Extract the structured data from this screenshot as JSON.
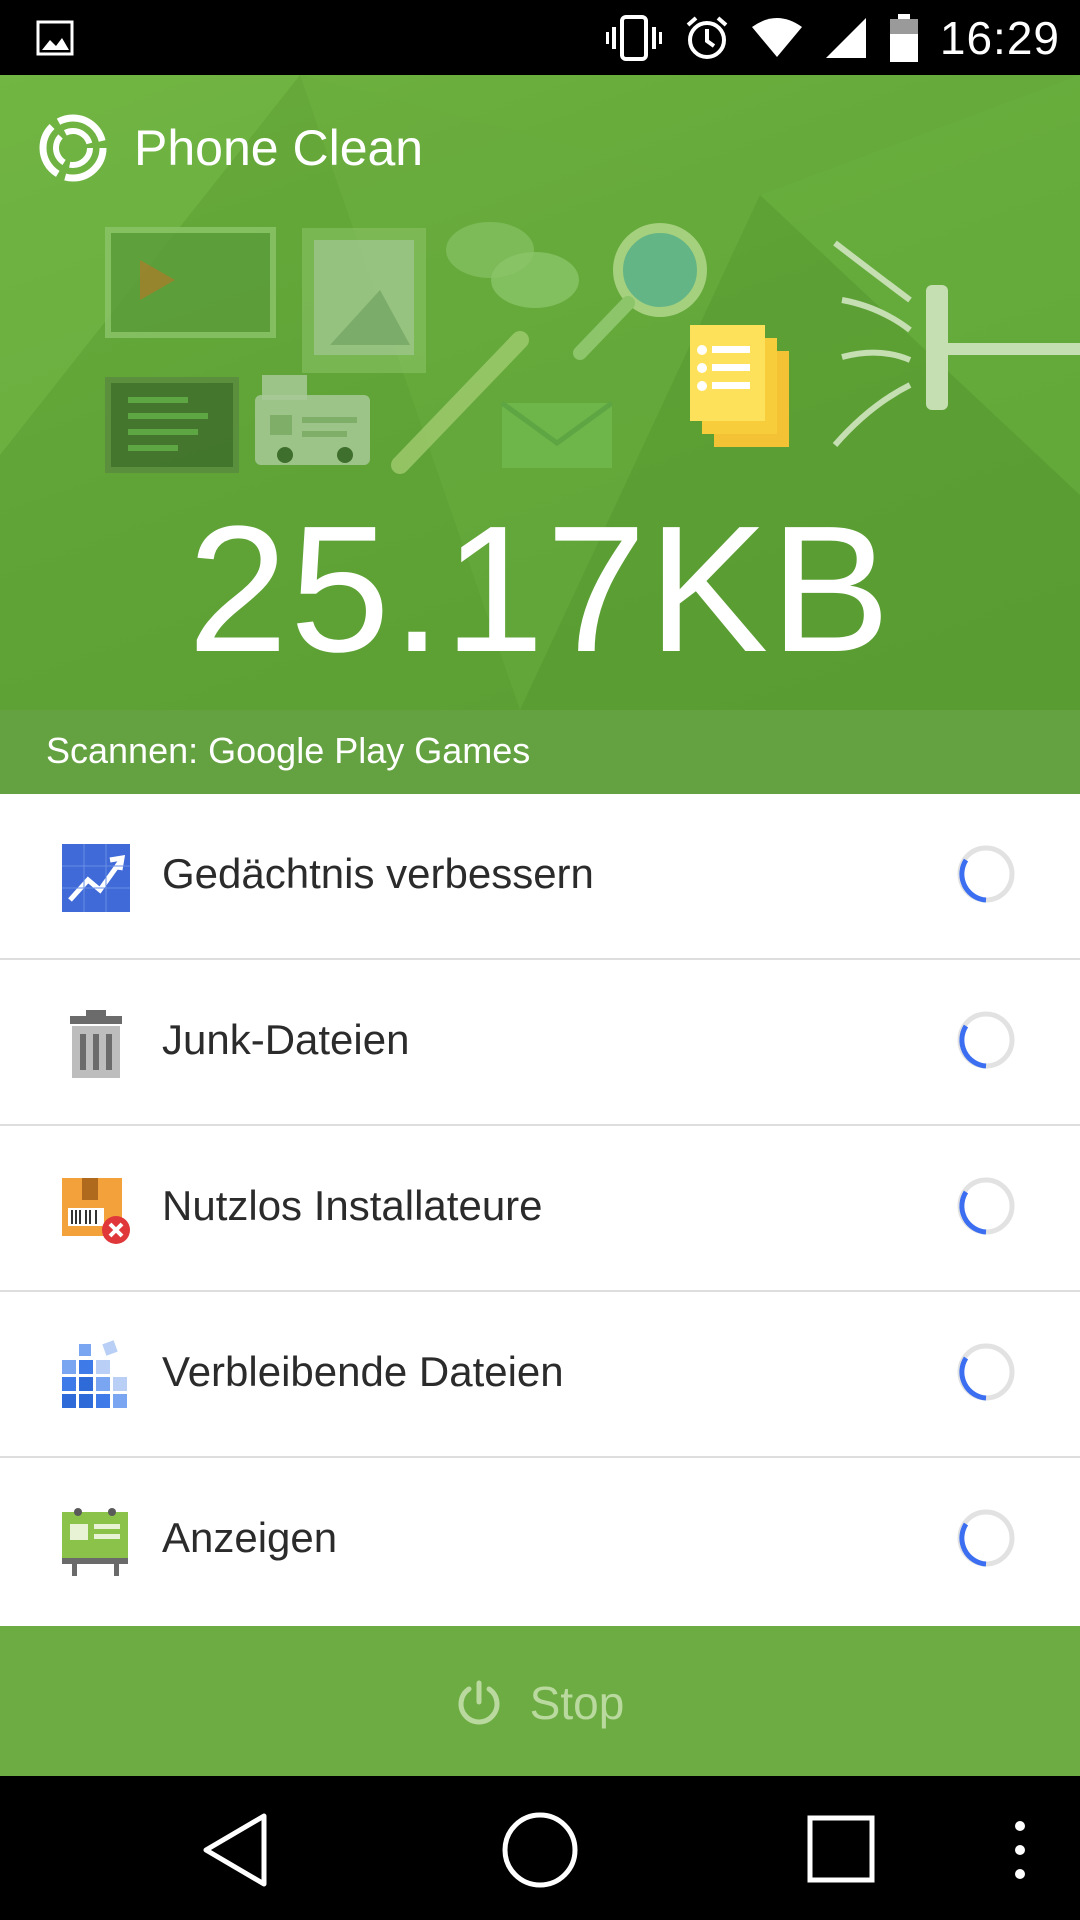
{
  "status_bar": {
    "time": "16:29",
    "icons": [
      "gallery-icon",
      "vibrate-icon",
      "alarm-icon",
      "wifi-icon",
      "signal-icon",
      "battery-icon"
    ]
  },
  "app": {
    "title": "Phone Clean",
    "logo_icon": "phone-clean-logo-icon"
  },
  "scan": {
    "size": "25.17KB",
    "status": "Scannen: Google Play Games"
  },
  "items": [
    {
      "label": "Gedächtnis verbessern",
      "icon": "memory-chart-icon"
    },
    {
      "label": "Junk-Dateien",
      "icon": "trash-icon"
    },
    {
      "label": "Nutzlos Installateure",
      "icon": "apk-box-icon"
    },
    {
      "label": "Verbleibende Dateien",
      "icon": "residual-blocks-icon"
    },
    {
      "label": "Anzeigen",
      "icon": "ad-billboard-icon"
    }
  ],
  "stop": {
    "label": "Stop",
    "icon": "power-icon"
  },
  "colors": {
    "brand_green": "#6dac43",
    "spinner_blue": "#3b6ef0"
  }
}
